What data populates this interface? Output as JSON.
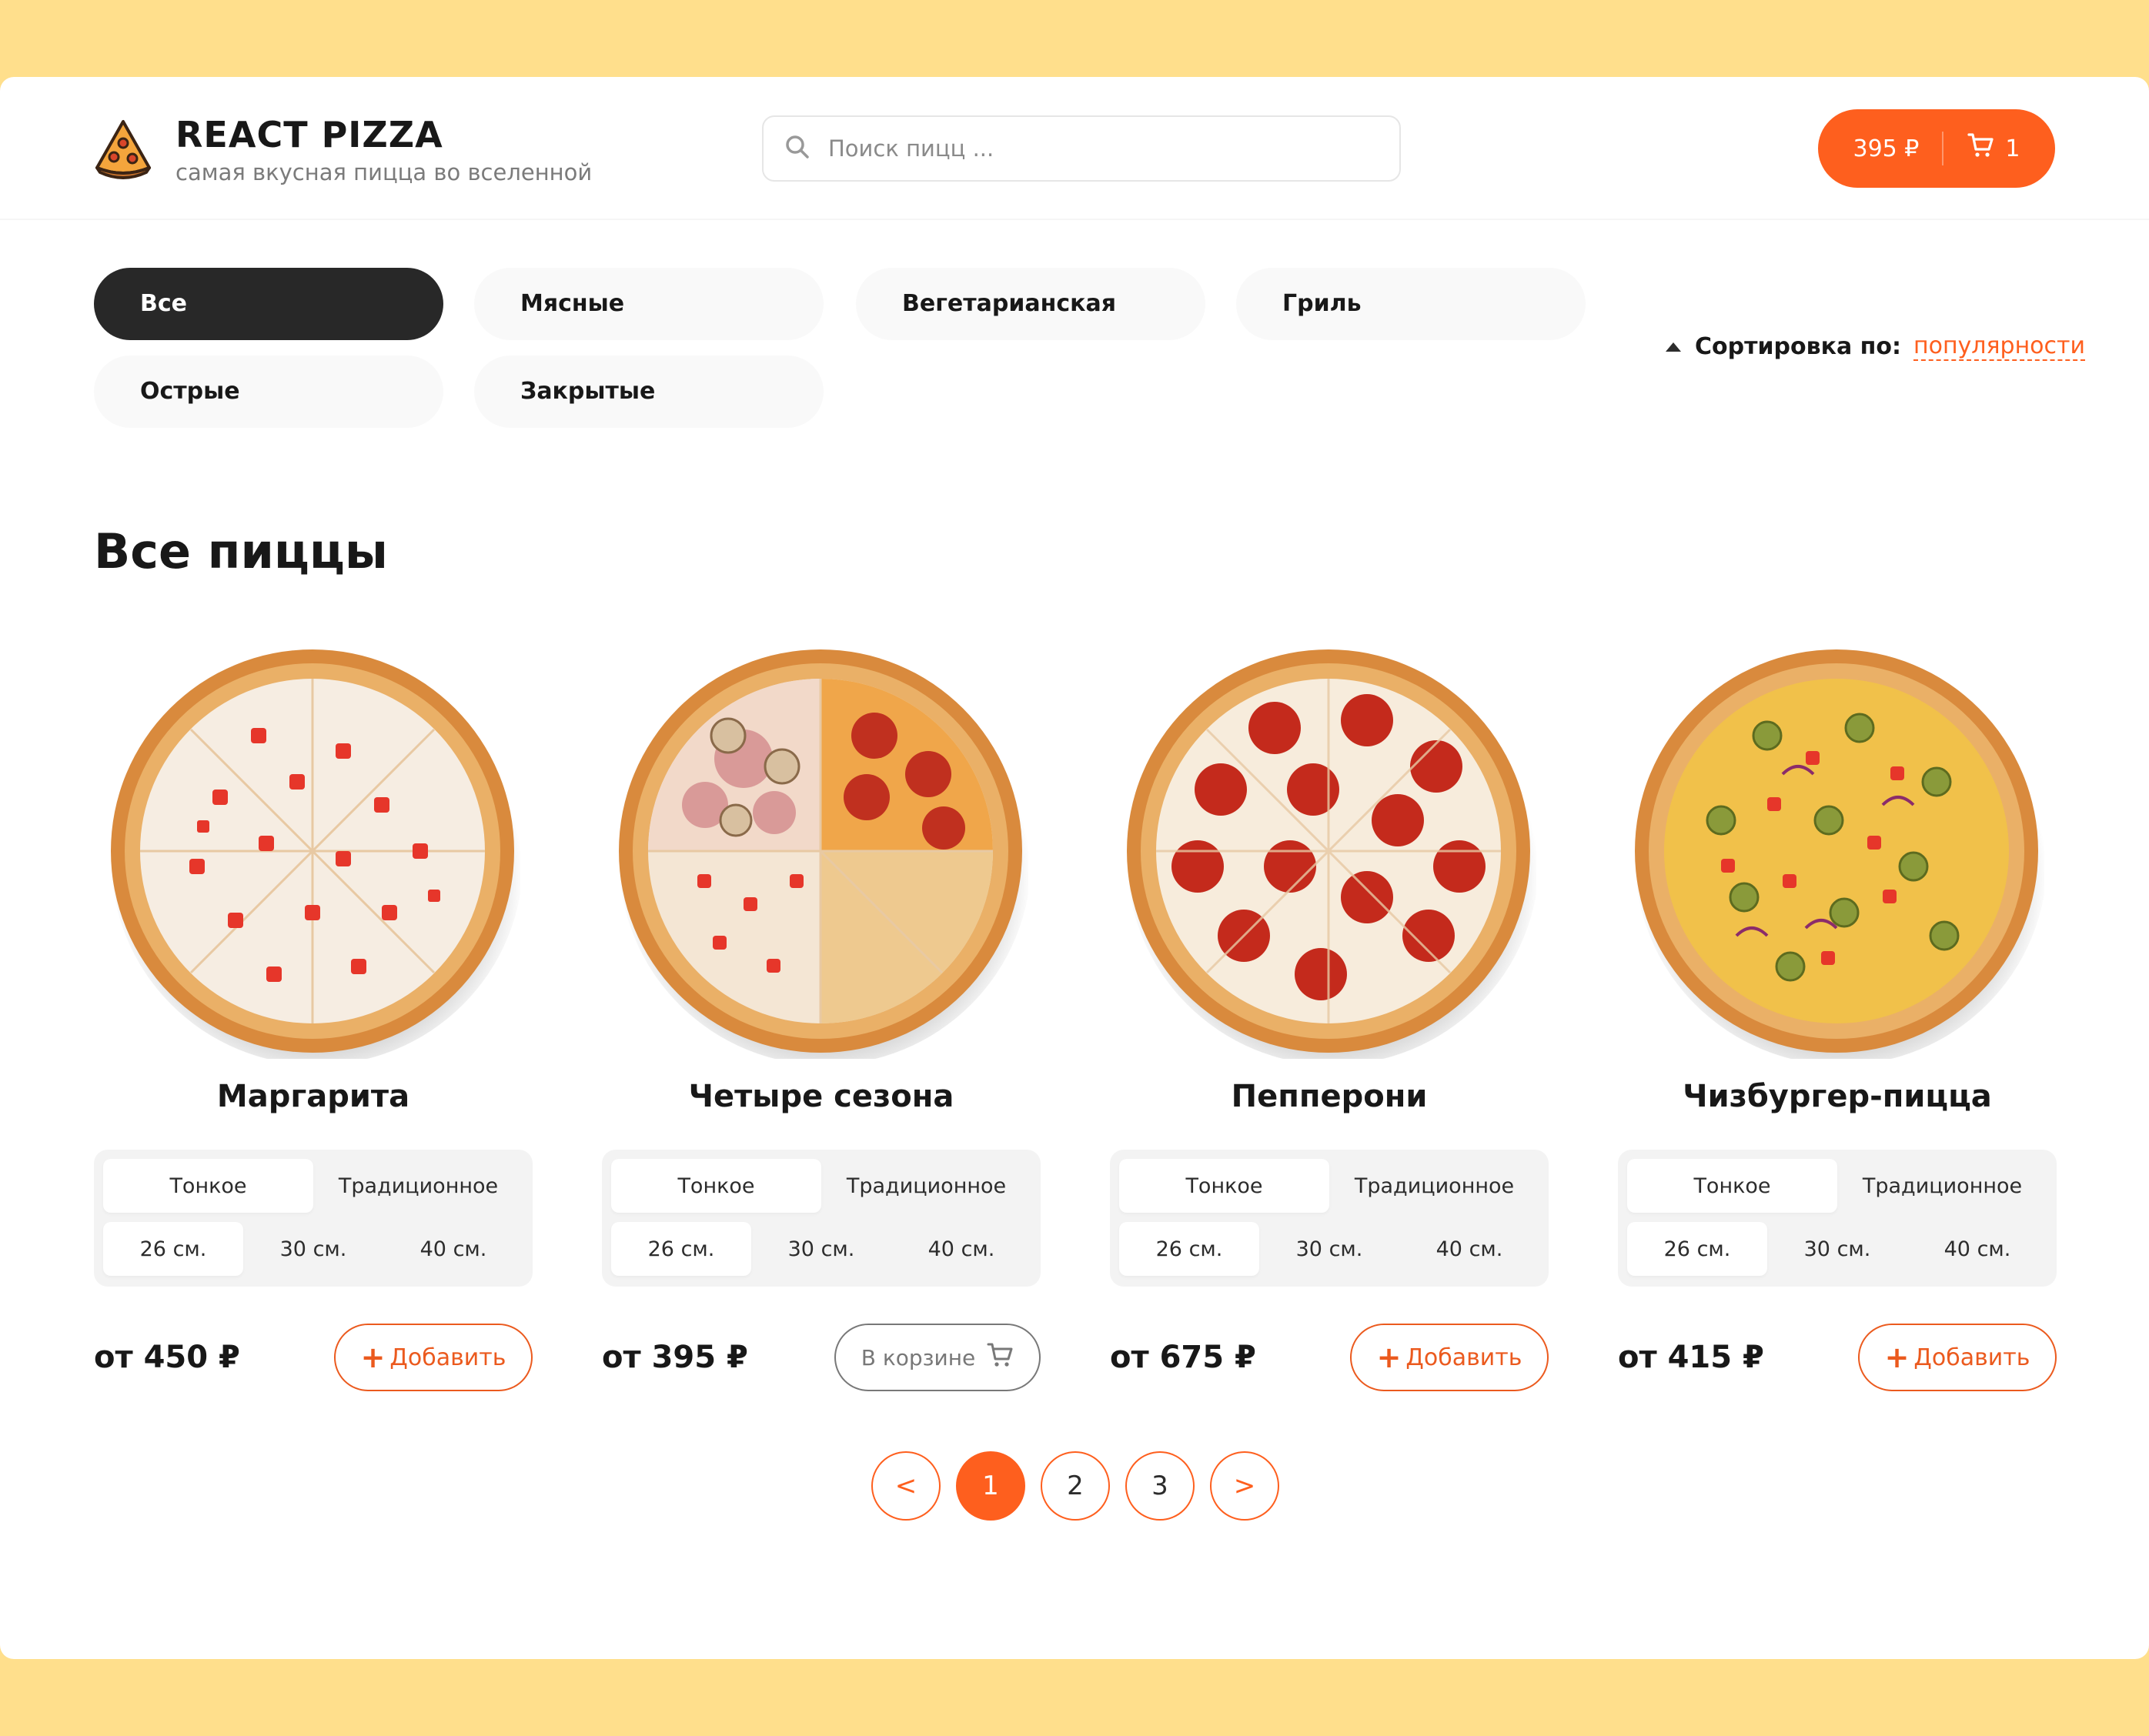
{
  "header": {
    "title": "REACT PIZZA",
    "subtitle": "самая вкусная пицца во вселенной",
    "search_placeholder": "Поиск пицц ...",
    "cart_price": "395 ₽",
    "cart_count": "1"
  },
  "categories": [
    {
      "label": "Все",
      "active": true
    },
    {
      "label": "Мясные",
      "active": false
    },
    {
      "label": "Вегетарианская",
      "active": false
    },
    {
      "label": "Гриль",
      "active": false
    },
    {
      "label": "Острые",
      "active": false
    },
    {
      "label": "Закрытые",
      "active": false
    }
  ],
  "sort": {
    "label": "Сортировка по:",
    "value": "популярности"
  },
  "section_title": "Все пиццы",
  "pizzas": [
    {
      "name": "Маргарита",
      "types": [
        "Тонкое",
        "Традиционное"
      ],
      "selected_type": 0,
      "sizes": [
        "26 см.",
        "30 см.",
        "40 см."
      ],
      "selected_size": 0,
      "price": "от 450 ₽",
      "button": "Добавить",
      "in_cart": false
    },
    {
      "name": "Четыре сезона",
      "types": [
        "Тонкое",
        "Традиционное"
      ],
      "selected_type": 0,
      "sizes": [
        "26 см.",
        "30 см.",
        "40 см."
      ],
      "selected_size": 0,
      "price": "от 395 ₽",
      "button": "В корзине",
      "in_cart": true
    },
    {
      "name": "Пепперони",
      "types": [
        "Тонкое",
        "Традиционное"
      ],
      "selected_type": 0,
      "sizes": [
        "26 см.",
        "30 см.",
        "40 см."
      ],
      "selected_size": 0,
      "price": "от 675 ₽",
      "button": "Добавить",
      "in_cart": false
    },
    {
      "name": "Чизбургер-пицца",
      "types": [
        "Тонкое",
        "Традиционное"
      ],
      "selected_type": 0,
      "sizes": [
        "26 см.",
        "30 см.",
        "40 см."
      ],
      "selected_size": 0,
      "price": "от 415 ₽",
      "button": "Добавить",
      "in_cart": false
    }
  ],
  "pagination": {
    "prev": "<",
    "pages": [
      "1",
      "2",
      "3"
    ],
    "active": "1",
    "next": ">"
  },
  "colors": {
    "accent": "#fe5f1e",
    "background": "#ffdf8c",
    "dark": "#282828"
  },
  "icons": [
    "pizza-logo-icon",
    "search-icon",
    "cart-icon",
    "plus-icon"
  ]
}
